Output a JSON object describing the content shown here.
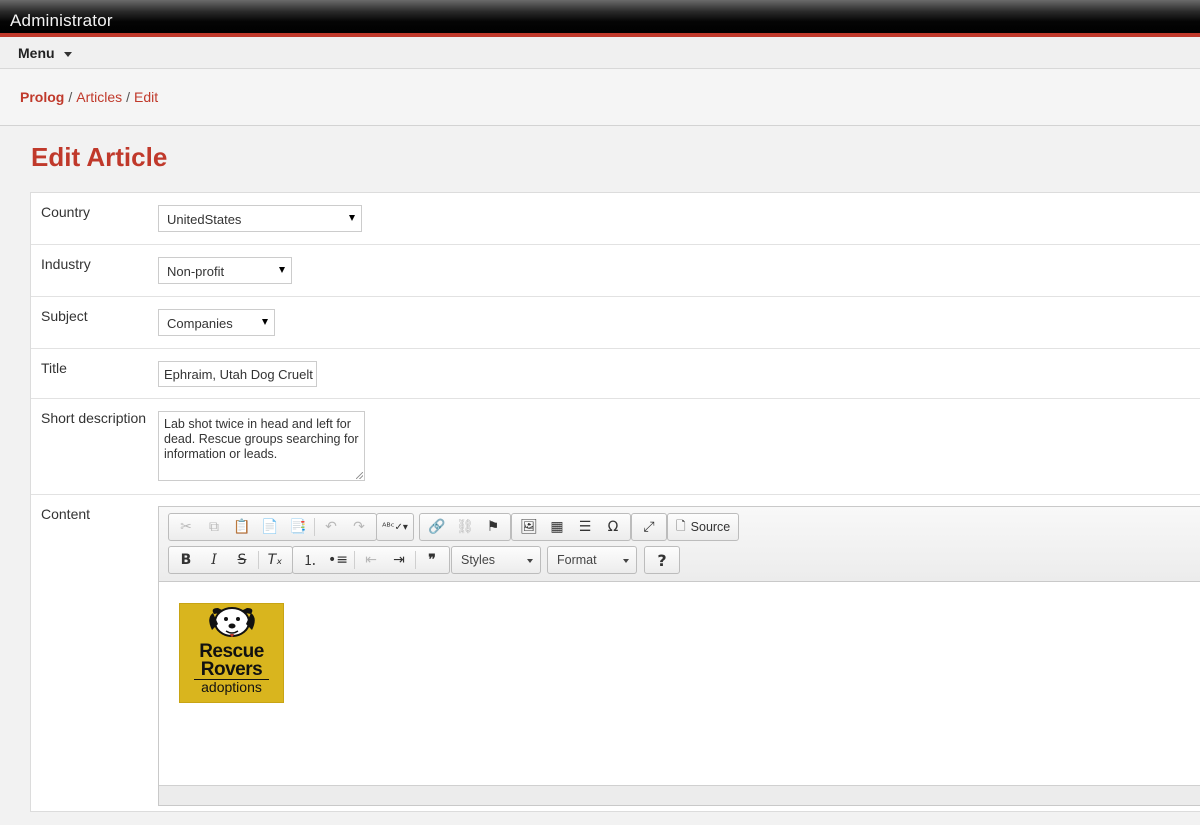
{
  "app": {
    "title": "Administrator"
  },
  "menu": {
    "label": "Menu"
  },
  "breadcrumb": {
    "root": "Prolog",
    "section": "Articles",
    "current": "Edit",
    "separator": "/"
  },
  "page": {
    "title": "Edit Article"
  },
  "colors": {
    "accent": "#c0392b",
    "logo_bg": "#d9b51e"
  },
  "form": {
    "country": {
      "label": "Country",
      "value": "UnitedStates"
    },
    "industry": {
      "label": "Industry",
      "value": "Non-profit"
    },
    "subject": {
      "label": "Subject",
      "value": "Companies"
    },
    "title": {
      "label": "Title",
      "value": "Ephraim, Utah Dog Cruelt"
    },
    "short_description": {
      "label": "Short description",
      "value": "Lab shot twice in head and left for dead. Rescue groups searching for information or leads."
    },
    "content": {
      "label": "Content"
    }
  },
  "editor": {
    "source_label": "Source",
    "styles_label": "Styles",
    "format_label": "Format",
    "help_label": "?",
    "image_text": {
      "line1": "Rescue",
      "line2": "Rovers",
      "line3": "adoptions"
    }
  },
  "icons": [
    "cut-icon",
    "copy-icon",
    "paste-icon",
    "paste-text-icon",
    "paste-word-icon",
    "undo-icon",
    "redo-icon",
    "spellcheck-icon",
    "link-icon",
    "unlink-icon",
    "anchor-icon",
    "image-icon",
    "table-icon",
    "horizontal-line-icon",
    "special-char-icon",
    "maximize-icon",
    "source-icon",
    "bold-icon",
    "italic-icon",
    "strike-icon",
    "remove-format-icon",
    "numbered-list-icon",
    "bullet-list-icon",
    "outdent-icon",
    "indent-icon",
    "blockquote-icon",
    "help-icon"
  ]
}
